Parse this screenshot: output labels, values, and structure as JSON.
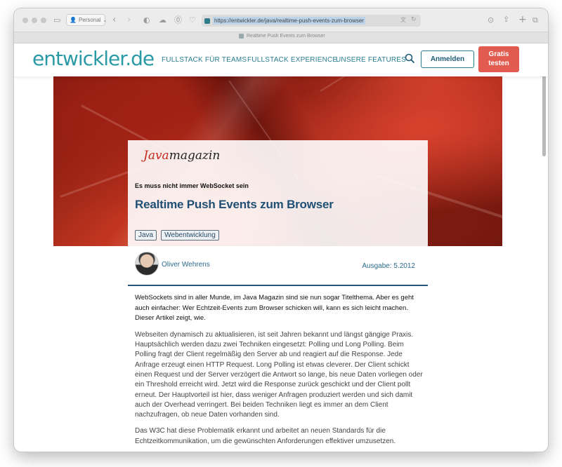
{
  "browser": {
    "profile_label": "Personal",
    "url": "https://entwickler.de/java/realtime-push-events-zum-browser",
    "tab_title": "Realtime Push Events zum Browser"
  },
  "site": {
    "logo_main": "entwickler",
    "logo_dot": ".",
    "logo_tld": "de",
    "nav": [
      "FULLSTACK FÜR TEAMS",
      "FULLSTACK EXPERIENCE",
      "UNSERE FEATURES"
    ],
    "login_label": "Anmelden",
    "trial_label_1": "Gratis",
    "trial_label_2": "testen",
    "accent": "#2a9aa6",
    "cta_color": "#e25b50"
  },
  "article": {
    "journal_java": "Java",
    "journal_mag": "magazin",
    "kicker": "Es muss nicht immer WebSocket sein",
    "title": "Realtime Push Events zum Browser",
    "tags": [
      "Java",
      "Webentwicklung"
    ],
    "author": "Oliver Wehrens",
    "issue": "Ausgabe: 5.2012",
    "lead": "WebSockets sind in aller Munde, im Java Magazin sind sie nun sogar Titelthema. Aber es geht auch einfacher: Wer Echtzeit-Events zum Browser schicken will, kann es sich leicht machen. Dieser Artikel zeigt, wie.",
    "paragraphs": [
      "Webseiten dynamisch zu aktualisieren, ist seit Jahren bekannt und längst gängige Praxis. Hauptsächlich werden dazu zwei Techniken eingesetzt: Polling und Long Polling. Beim Polling fragt der Client regelmäßig den Server ab und reagiert auf die Response. Jede Anfrage erzeugt einen HTTP Request. Long Polling ist etwas cleverer. Der Client schickt einen Request und der Server verzögert die Antwort so lange, bis neue Daten vorliegen oder ein Threshold erreicht wird. Jetzt wird die Response zurück geschickt und der Client pollt erneut. Der Hauptvorteil ist hier, dass weniger Anfragen produziert werden und sich damit auch der Overhead verringert. Bei beiden Techniken liegt es immer an dem Client nachzufragen, ob neue Daten vorhanden sind.",
      "Das W3C hat diese Problematik erkannt und arbeitet an neuen Standards für die Echtzeitkommunikation, um die gewünschten Anforderungen effektiver umzusetzen."
    ]
  }
}
